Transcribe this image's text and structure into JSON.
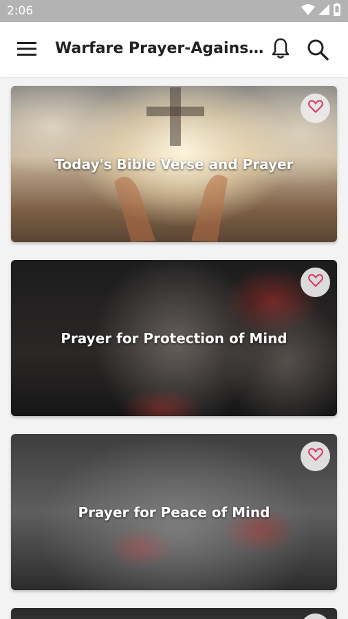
{
  "status_bar": {
    "time": "2:06",
    "icons": [
      "wifi-icon",
      "signal-icon",
      "battery-icon"
    ]
  },
  "app_bar": {
    "title": "Warfare Prayer-Against e...",
    "menu_icon": "hamburger-menu-icon",
    "notification_icon": "bell-icon",
    "search_icon": "search-icon"
  },
  "cards": [
    {
      "title": "Today's Bible Verse and Prayer",
      "favorite_icon": "heart-outline-icon"
    },
    {
      "title": "Prayer for Protection of Mind",
      "favorite_icon": "heart-outline-icon"
    },
    {
      "title": "Prayer for Peace of Mind",
      "favorite_icon": "heart-outline-icon"
    }
  ],
  "colors": {
    "status_bar": "#b3b3b3",
    "app_bar": "#ffffff",
    "background": "#f3f3f3",
    "heart": "#d9365e"
  }
}
